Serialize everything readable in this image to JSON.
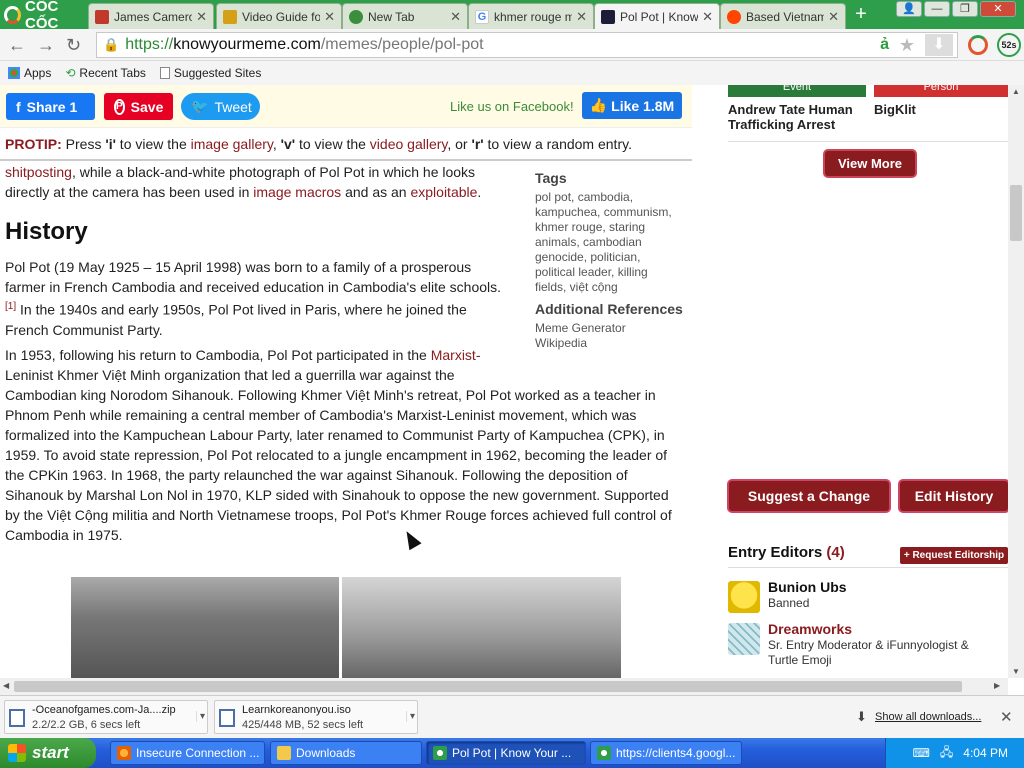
{
  "browser": {
    "brand": "CỐC CỐC",
    "tabs": [
      {
        "label": "James Cameron",
        "color": "#c0392b"
      },
      {
        "label": "Video Guide for",
        "color": "#d4a017"
      },
      {
        "label": "New Tab",
        "color": "#3b8e3b"
      },
      {
        "label": "khmer rouge me",
        "color": "#4285f4"
      },
      {
        "label": "Pol Pot | Know",
        "color": "#1d1d3a"
      },
      {
        "label": "Based Vietnam",
        "color": "#ff4500"
      }
    ],
    "url": {
      "scheme": "https://",
      "host": "knowyourmeme.com",
      "path": "/memes/people/pol-pot"
    },
    "timer_badge": "52s",
    "bookmarks": [
      "Apps",
      "Recent Tabs",
      "Suggested Sites"
    ]
  },
  "sharebar": {
    "share_label": "Share 1",
    "save_label": "Save",
    "tweet_label": "Tweet",
    "like_us": "Like us on Facebook!",
    "like_btn": "Like 1.8M"
  },
  "protip": {
    "label": "PROTIP:",
    "t1": " Press ",
    "k1": "'i'",
    "t2": " to view the ",
    "l1": "image gallery",
    "t3": ", ",
    "k2": "'v'",
    "t4": " to view the ",
    "l2": "video gallery",
    "t5": ", or ",
    "k3": "'r'",
    "t6": " to view a random entry."
  },
  "intro": {
    "link1": "shitposting",
    "text1": ", while a black-and-white photograph of Pol Pot in which he looks",
    "text2": "directly at the camera has been used in ",
    "link2": "image macros",
    "text3": " and as an ",
    "link3": "exploitable",
    "text4": "."
  },
  "history_heading": "History",
  "para1": {
    "line1": "Pol Pot (19 May 1925 – 15 April 1998) was born to a family of a prosperous",
    "line2": "farmer in French Cambodia and received education in Cambodia's elite schools.",
    "ref": "[1]",
    "line3": " In the 1940s and early 1950s, Pol Pot lived in Paris, where he joined the",
    "line4": "French Communist Party."
  },
  "para2": {
    "t1": "In 1953, following his return to Cambodia, Pol Pot participated in the ",
    "link": "Marxist-",
    "lines": [
      "Leninist Khmer Việt Minh organization that led a guerrilla war against the",
      "Cambodian king Norodom Sihanouk. Following Khmer Việt Minh's retreat, Pol Pot worked as a teacher in",
      "Phnom Penh while remaining a central member of Cambodia's Marxist-Leninist movement, which was",
      "formalized into the Kampuchean Labour Party, later renamed to Communist Party of Kampuchea (CPK), in",
      "1959. To avoid state repression, Pol Pot relocated to a jungle encampment in 1962, becoming the leader of",
      "the CPKin 1963. In 1968, the party relaunched the war against Sihanouk. Following the deposition of",
      "Sihanouk by Marshal Lon Nol in 1970, KLP sided with Sinahouk to oppose the new government. Supported",
      "by the Việt Cộng militia and North Vietnamese troops, Pol Pot's Khmer Rouge forces achieved full control of",
      "Cambodia in 1975."
    ]
  },
  "sidebar_tags": {
    "heading": "Tags",
    "lines": [
      "pol pot, cambodia,",
      "kampuchea, communism,",
      "khmer rouge, staring",
      "animals, cambodian",
      "genocide, politician,",
      "political leader, killing",
      "fields, việt cộng"
    ],
    "refs_heading": "Additional References",
    "refs": [
      "Meme Generator",
      "Wikipedia"
    ]
  },
  "right": {
    "cat1": "Event",
    "cat2": "Person",
    "card1": "Andrew Tate Human Trafficking Arrest",
    "card2": "BigKlit",
    "view_more": "View More",
    "suggest": "Suggest a Change",
    "edit_history": "Edit History",
    "editors_title": "Entry Editors",
    "editors_count": "(4)",
    "request": "+ Request Editorship",
    "editors": [
      {
        "name": "Bunion Ubs",
        "role": "Banned",
        "link": false
      },
      {
        "name": "Dreamworks",
        "role": "Sr. Entry Moderator & iFunnyologist & Turtle Emoji",
        "link": true
      }
    ]
  },
  "downloads": [
    {
      "name": "-Oceanofgames.com-Ja....zip",
      "status": "2.2/2.2 GB, 6 secs left"
    },
    {
      "name": "Learnkoreanonyou.iso",
      "status": "425/448 MB, 52 secs left"
    }
  ],
  "show_all": "Show all downloads...",
  "taskbar": {
    "start": "start",
    "tasks": [
      "Insecure Connection ...",
      "Downloads",
      "Pol Pot | Know Your ...",
      "https://clients4.googl..."
    ],
    "clock": "4:04 PM"
  }
}
